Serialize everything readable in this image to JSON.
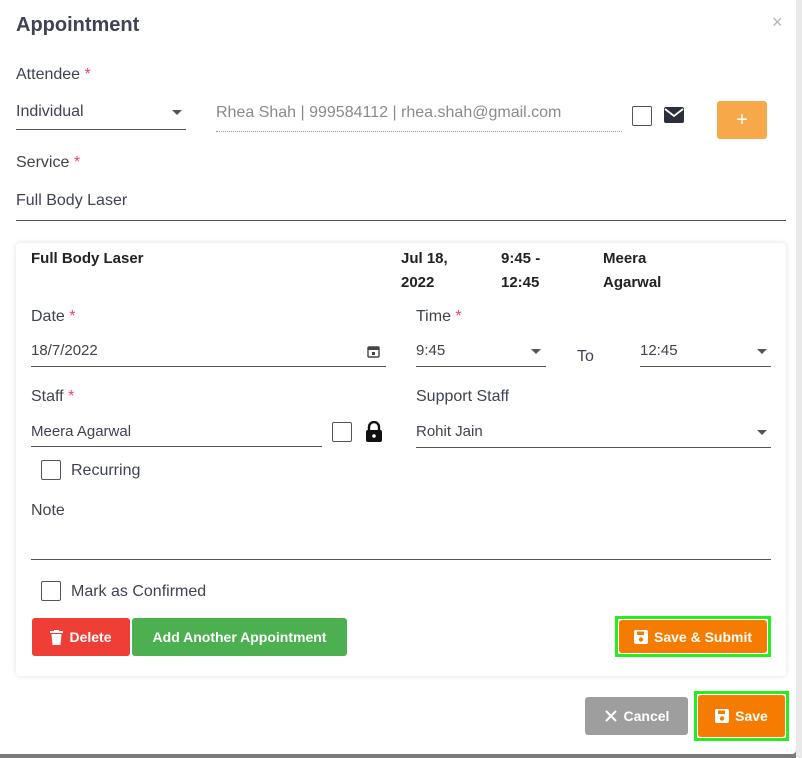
{
  "modal": {
    "title": "Appointment",
    "close": "×"
  },
  "attendee": {
    "label": "Attendee",
    "required": "*",
    "type_value": "Individual",
    "contact_value": "Rhea  Shah | 999584112 | rhea.shah@gmail.com",
    "add_label": "+"
  },
  "service": {
    "label": "Service",
    "required": "*",
    "value": "Full Body Laser"
  },
  "summary": {
    "service": "Full Body Laser",
    "date_line1": "Jul 18,",
    "date_line2": "2022",
    "time_line1": "9:45 -",
    "time_line2": "12:45",
    "staff_line1": "Meera",
    "staff_line2": "Agarwal"
  },
  "date": {
    "label": "Date",
    "required": "*",
    "value": "18/7/2022"
  },
  "time": {
    "label": "Time",
    "required": "*",
    "start": "9:45",
    "to_label": "To",
    "end": "12:45"
  },
  "staff": {
    "label": "Staff",
    "required": "*",
    "value": "Meera Agarwal"
  },
  "support_staff": {
    "label": "Support Staff",
    "value": "Rohit Jain"
  },
  "recurring": {
    "label": "Recurring"
  },
  "note": {
    "label": "Note",
    "value": ""
  },
  "confirmed": {
    "label": "Mark as Confirmed"
  },
  "buttons": {
    "delete": "Delete",
    "add_another": "Add Another Appointment",
    "save_submit": "Save & Submit",
    "cancel": "Cancel",
    "save": "Save"
  },
  "colors": {
    "delete": "#ef3e36",
    "add_another": "#4caf50",
    "save": "#f57c00",
    "cancel": "#9e9e9e",
    "plus": "#f7a94a",
    "highlight": "#22ee22"
  }
}
